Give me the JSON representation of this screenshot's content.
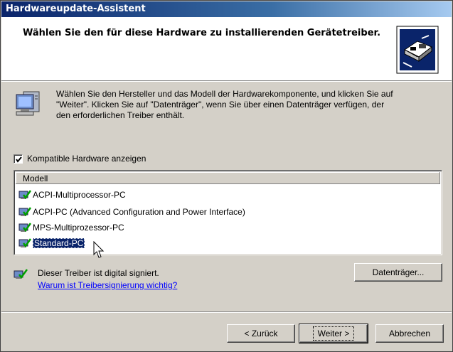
{
  "window": {
    "title": "Hardwareupdate-Assistent"
  },
  "header": {
    "title": "Wählen Sie den für diese Hardware zu installierenden Gerätetreiber."
  },
  "intro": {
    "line1": "Wählen Sie den Hersteller und das Modell der Hardwarekomponente, und klicken Sie auf",
    "line2": "\"Weiter\". Klicken Sie auf \"Datenträger\", wenn Sie über einen Datenträger verfügen, der",
    "line3": "den erforderlichen Treiber enthält."
  },
  "compatible_checkbox": {
    "label": "Kompatible Hardware anzeigen",
    "checked": true
  },
  "model_list": {
    "column_header": "Modell",
    "items": [
      {
        "label": "ACPI-Multiprocessor-PC",
        "selected": false
      },
      {
        "label": "ACPI-PC (Advanced Configuration and Power Interface)",
        "selected": false
      },
      {
        "label": "MPS-Multiprozessor-PC",
        "selected": false
      },
      {
        "label": "Standard-PC",
        "selected": true
      }
    ]
  },
  "signature": {
    "status": "Dieser Treiber ist digital signiert.",
    "link": "Warum ist Treibersignierung wichtig?"
  },
  "buttons": {
    "disk": "Datenträger...",
    "back": "< Zurück",
    "next": "Weiter >",
    "cancel": "Abbrechen"
  },
  "colors": {
    "titlebar_start": "#0a246a",
    "titlebar_end": "#a6caf0",
    "dialog_face": "#d4d0c8",
    "selection": "#0a246a",
    "link": "#0000ff"
  },
  "icons": {
    "header": "hardware-card-icon",
    "intro": "computer-monitor-icon",
    "list_item": "computer-driver-check-icon",
    "signature": "driver-signed-icon",
    "cursor": "mouse-pointer-icon"
  }
}
